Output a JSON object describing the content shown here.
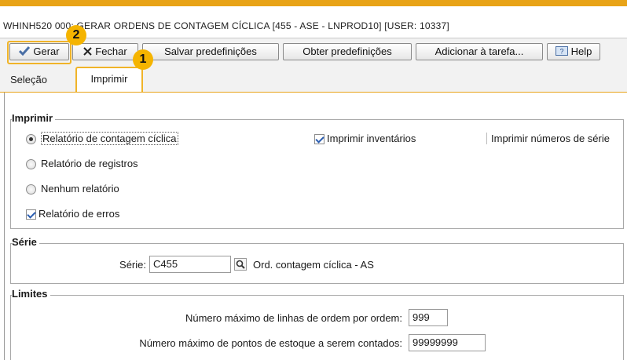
{
  "window": {
    "title": "WHINH520   000: GERAR ORDENS DE CONTAGEM CÍCLICA [455 - ASE  - LNPROD10] [USER: 10337]"
  },
  "toolbar": {
    "gerar_label": "Gerar",
    "fechar_label": "Fechar",
    "salvar_label": "Salvar predefinições",
    "obter_label": "Obter predefinições",
    "adicionar_label": "Adicionar à tarefa...",
    "help_label": "Help"
  },
  "annotations": {
    "badge1": "1",
    "badge2": "2"
  },
  "tabs": {
    "selecao": "Seleção",
    "imprimir": "Imprimir"
  },
  "imprimir": {
    "legend": "Imprimir",
    "opt_contagem": "Relatório de contagem cíclica",
    "opt_registros": "Relatório de registros",
    "opt_nenhum": "Nenhum relatório",
    "chk_erros": "Relatório de erros",
    "chk_inventarios": "Imprimir inventários",
    "chk_numeros_serie": "Imprimir números de série",
    "selected_radio": "Relatório de contagem cíclica"
  },
  "serie": {
    "legend": "Série",
    "label": "Série:",
    "value": "C455",
    "description": "Ord. contagem cíclica  - AS"
  },
  "limites": {
    "legend": "Limites",
    "max_linhas_label": "Número máximo de linhas de ordem por ordem:",
    "max_linhas_value": "999",
    "max_pontos_label": "Número máximo de pontos de estoque a serem contados:",
    "max_pontos_value": "99999999"
  },
  "colors": {
    "accent": "#e8a317",
    "highlight": "#f0b429",
    "badge": "#f5b400"
  },
  "icons": {
    "gerar": "checkmark-icon",
    "fechar": "close-x-icon",
    "help": "help-icon",
    "search": "search-icon"
  }
}
